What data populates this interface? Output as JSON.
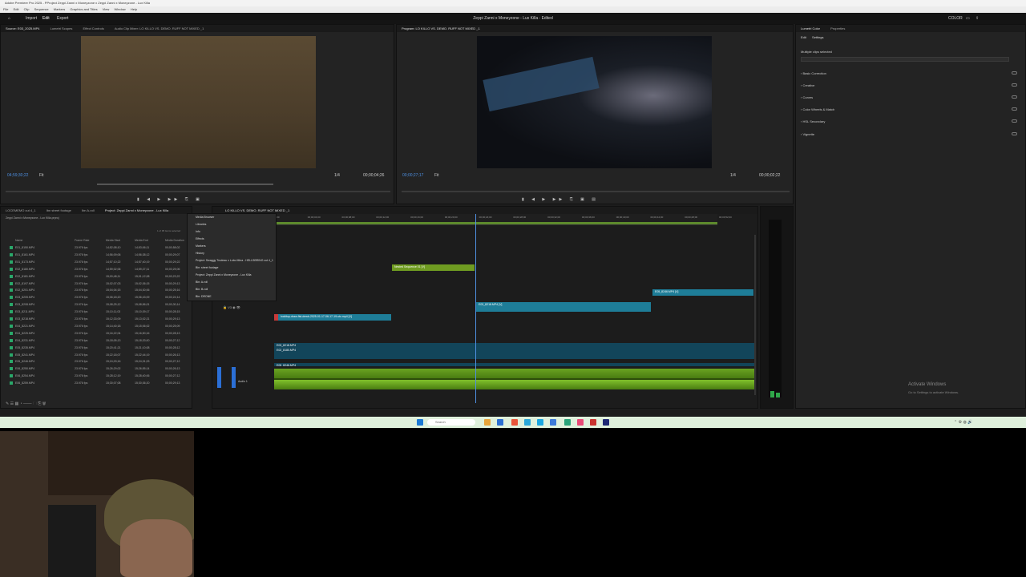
{
  "window": {
    "title": "Adobe Premiere Pro 2025 - PProject Zeppi Zanni x Moneyzone x Zeppi Zanni x Moneyzone - Lux Killa"
  },
  "menu": [
    "File",
    "Edit",
    "Clip",
    "Sequence",
    "Markers",
    "Graphics and Titles",
    "View",
    "Window",
    "Help"
  ],
  "appbar": {
    "tabs": [
      "Import",
      "Edit",
      "Export"
    ],
    "active": "Edit",
    "title": "Zeppi Zanni x Moneyzone - Lux Killa - Edited",
    "color_label": "COLOR"
  },
  "source": {
    "tabs": [
      "Source: E03_2025.MP4",
      "Lumetri Scopes",
      "Effect Controls",
      "Audio Clip Mixer: LO KILLO VS. DEMO. RUFF NOT MIXED _1"
    ],
    "tc_left": "04;59;30;22",
    "fit": "Fit",
    "tc_right": "00;00;04;26",
    "res": "1/4"
  },
  "program": {
    "tab": "Program: LO KILLO VS. DEMO. RUFF NOT MIXED _1",
    "tc_left": "00;00;27;17",
    "fit": "Fit",
    "tc_right": "00;00;02;22",
    "res": "1/4"
  },
  "lumetri": {
    "tabs": [
      "Lumetri Color",
      "Properties"
    ],
    "subtabs": [
      "Edit",
      "Settings"
    ],
    "clip_label": "Multiple clips selected",
    "sections": [
      "Basic Correction",
      "Creative",
      "Curves",
      "Color Wheels & Match",
      "HSL Secondary",
      "Vignette"
    ]
  },
  "project": {
    "tabs": [
      "LOCEMEMO cut 4_1",
      "Ibn street footage",
      "Ibn A-roll",
      "Project: Zeppi Zanni x Moneyzone - Lux Killa",
      "Bin: Pr"
    ],
    "breadcrumb": "Zeppi Zanni x Moneyzone - Lux Killa.prproj",
    "count": "1 of 95 items selected",
    "headers": [
      "Name",
      "Frame Rate",
      "Media Start",
      "Media End",
      "Media Duration"
    ],
    "rows": [
      [
        "E01_8150.MP4",
        "23.976 fps",
        "14;52;08;10",
        "14;53;06;11",
        "00;00;58;02"
      ],
      [
        "E01_8161.MP4",
        "23.976 fps",
        "14;56;09;06",
        "14;56;38;12",
        "00;00;29;07"
      ],
      [
        "E01_8173.MP4",
        "23.976 fps",
        "14;57;10;22",
        "14;57;40;19",
        "00;00;29;22"
      ],
      [
        "E02_8180.MP4",
        "23.976 fps",
        "14;59;02;06",
        "14;59;27;11",
        "00;00;25;06"
      ],
      [
        "E02_8181.MP4",
        "23.976 fps",
        "15;00;48;11",
        "15;01;12;08",
        "00;00;23;22"
      ],
      [
        "E02_8197.MP4",
        "23.976 fps",
        "15;02;07;03",
        "15;02;36;15",
        "00;00;29;13"
      ],
      [
        "E02_8201.MP4",
        "23.976 fps",
        "15;04;04;15",
        "15;04;30;06",
        "00;00;25;16"
      ],
      [
        "E03_8205.MP4",
        "23.976 fps",
        "15;06;18;20",
        "15;06;43;09",
        "00;00;24;14"
      ],
      [
        "E03_8208.MP4",
        "23.976 fps",
        "15;08;25;12",
        "15;08;56;01",
        "00;00;30;14"
      ],
      [
        "E03_8211.MP4",
        "23.976 fps",
        "15;10;11;03",
        "15;10;39;17",
        "00;00;28;15"
      ],
      [
        "E03_8218.MP4",
        "23.976 fps",
        "15;12;33;09",
        "15;13;02;21",
        "00;00;29;13"
      ],
      [
        "E04_8221.MP4",
        "23.976 fps",
        "15;14;40;18",
        "15;15;06;02",
        "00;00;25;09"
      ],
      [
        "E04_8225.MP4",
        "23.976 fps",
        "15;16;22;04",
        "15;16;50;16",
        "00;00;28;13"
      ],
      [
        "E04_8231.MP4",
        "23.976 fps",
        "15;18;05;13",
        "15;18;33;00",
        "00;00;27;12"
      ],
      [
        "E05_8235.MP4",
        "23.976 fps",
        "15;20;41;21",
        "15;21;10;08",
        "00;00;28;12"
      ],
      [
        "E05_8241.MP4",
        "23.976 fps",
        "15;22;18;07",
        "15;22;44;19",
        "00;00;26;13"
      ],
      [
        "E05_8246.MP4",
        "23.976 fps",
        "15;24;03;16",
        "15;24;31;03",
        "00;00;27;12"
      ],
      [
        "E06_8250.MP4",
        "23.976 fps",
        "15;26;29;02",
        "15;26;55;14",
        "00;00;26;13"
      ],
      [
        "E06_8254.MP4",
        "23.976 fps",
        "15;28;12;19",
        "15;28;40;06",
        "00;00;27;12"
      ],
      [
        "E06_8259.MP4",
        "23.976 fps",
        "15;30;07;08",
        "15;30;36;20",
        "00;00;29;13"
      ]
    ]
  },
  "dropdown": [
    "Media Browser",
    "Libraries",
    "Info",
    "Effects",
    "Markers",
    "History",
    "Project: Swaggy Trudeau x Lobo Mina - HELLSBRING cut 4_1",
    "Bin: street footage",
    "Project: Zeppi Zanni x Moneyzone - Lux Killa",
    "Bin: A-roll",
    "Bin: B-roll",
    "Bin: DRONE"
  ],
  "timeline": {
    "tab": "LO KILLO VS. DEMO. RUFF NOT MIXED _1",
    "timecode": "00;00;27;17",
    "ruler": [
      "00;00",
      "00;00;04;00",
      "00;00;08;00",
      "00;00;12;00",
      "00;00;16;00",
      "00;00;20;00",
      "00;00;24;00",
      "00;00;28;00",
      "00;00;32;00",
      "00;00;36;00",
      "00;00;40;00",
      "00;00;44;00",
      "00;00;48;00",
      "00;00;52;00"
    ],
    "clips": {
      "nested": "Nested Sequence 01 [V]",
      "c2": "E05_8246.MP4 [V]",
      "c3": "E03_8218.MP4 [V]",
      "c4": "lockitup-draw-fist-dewb-2025-01-17-06-17-19-utc.mp4 [V]",
      "a1": "E03_8218.MP4",
      "a2": "E02_8180.MP4",
      "a3": "E05_8246.MP4",
      "a4": "E04_8221.MP4"
    },
    "audio_label": "Audio 1"
  },
  "watermark": {
    "line1": "Activate Windows",
    "line2": "Go to Settings to activate Windows."
  },
  "taskbar": {
    "search": "Search"
  },
  "colors": {
    "accent": "#4c8ee0",
    "clip_teal": "#1e7d98",
    "clip_green": "#6f9b21",
    "clip_pink": "#d93d88",
    "clip_red": "#c63a3a"
  }
}
